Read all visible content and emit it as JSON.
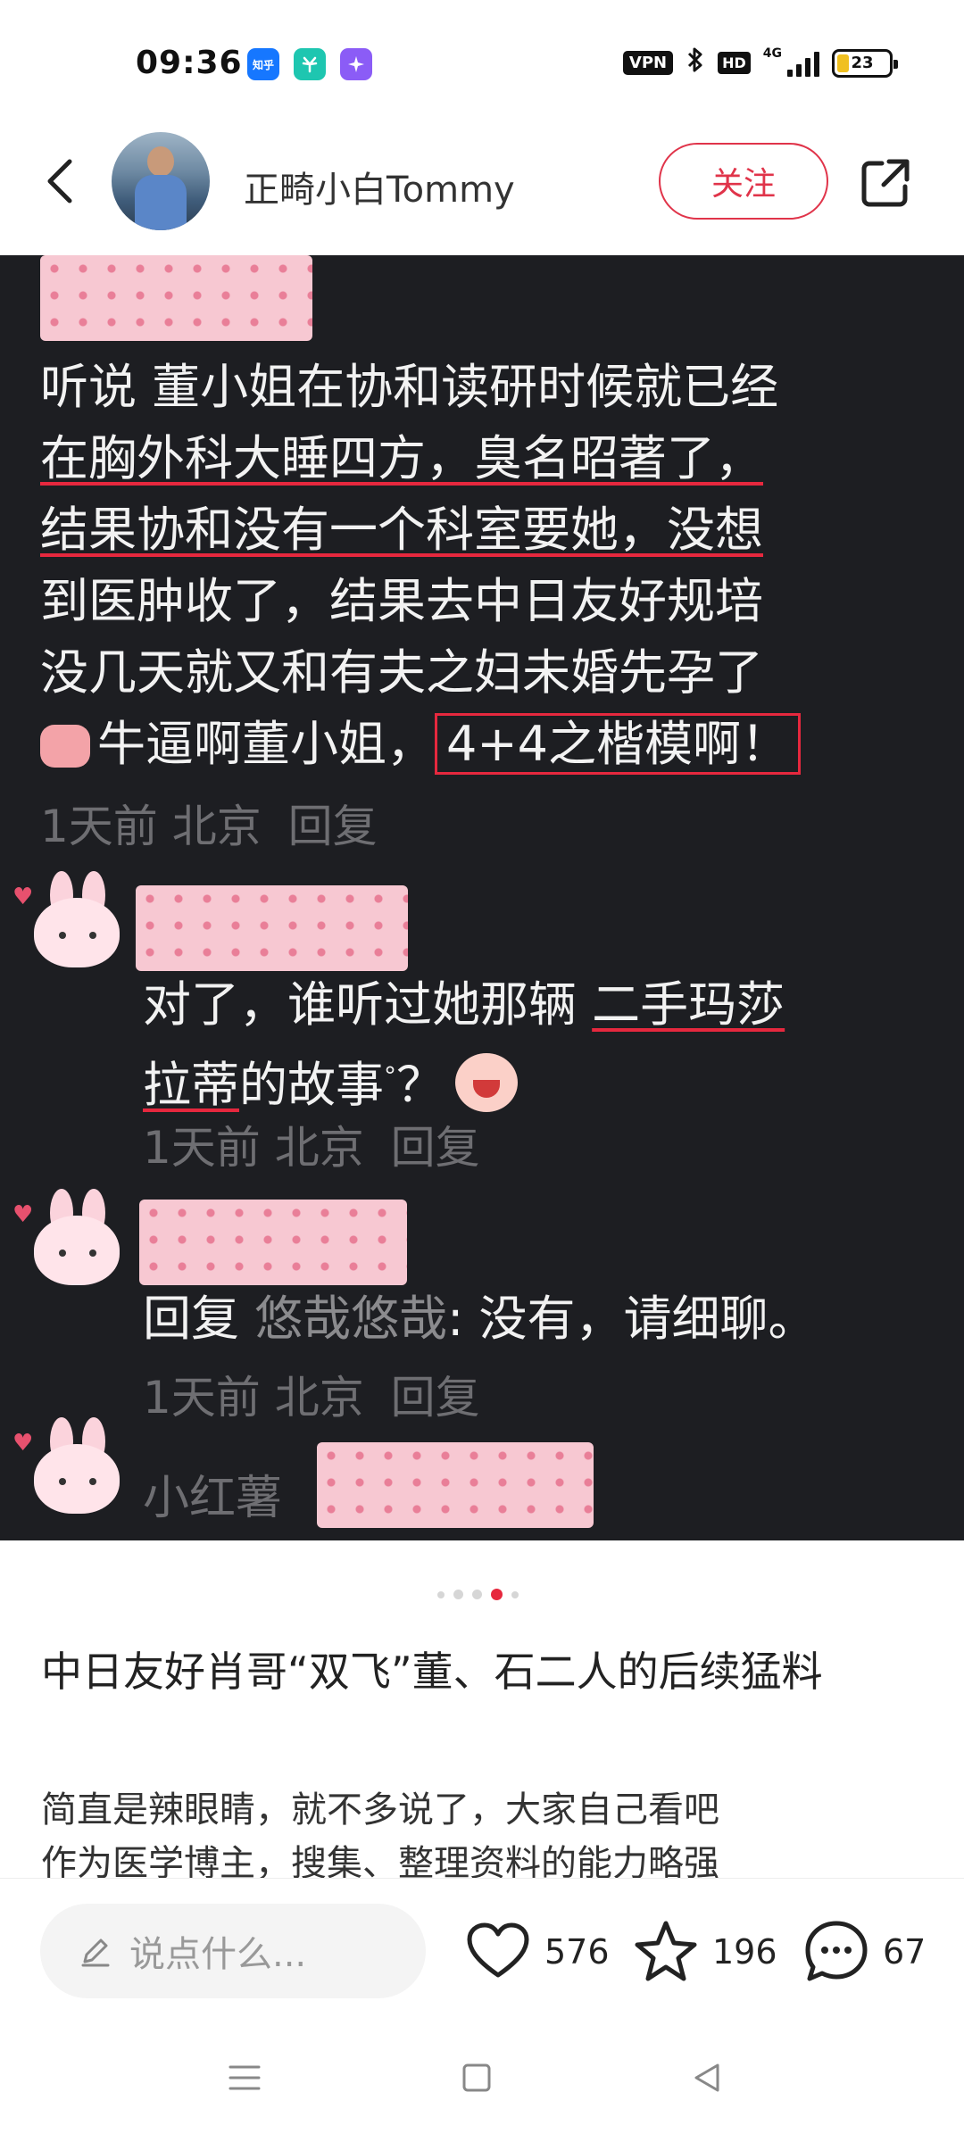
{
  "status_bar": {
    "time": "09:36",
    "app_badges": [
      "知乎",
      "wave",
      "star"
    ],
    "vpn": "VPN",
    "hd": "HD",
    "network": "4G",
    "battery": "23",
    "battery_level": 0.23
  },
  "header": {
    "author_name": "正畸小白Tommy",
    "follow_label": "关注"
  },
  "post_image": {
    "comment1": {
      "lines": [
        "听说 董小姐在协和读研时候就已经",
        "在胸外科大睡四方，臭名昭著了，",
        "结果协和没有一个科室要她，没想",
        "到医肿收了，结果去中日友好规培",
        "没几天就又和有夫之妇未婚先孕了"
      ],
      "last_line_prefix": "牛逼啊董小姐，",
      "last_line_boxed": "4+4之楷模啊！",
      "meta_time": "1天前",
      "meta_loc": "北京",
      "meta_reply": "回复"
    },
    "comment2": {
      "line1_plain": "对了，谁听过她那辆 ",
      "line1_ul": "二手玛莎",
      "line2_ul": "拉蒂",
      "line2_rest": "的故事",
      "line2_end": "？",
      "meta_time": "1天前",
      "meta_loc": "北京",
      "meta_reply": "回复"
    },
    "comment3": {
      "reply_label": "回复",
      "reply_to": "悠哉悠哉",
      "text": ": 没有，请细聊。",
      "meta_time": "1天前",
      "meta_loc": "北京",
      "meta_reply": "回复"
    },
    "comment4": {
      "name": "小红薯"
    }
  },
  "carousel": {
    "count": 5,
    "active_index": 3
  },
  "post": {
    "title": "中日友好肖哥“双飞”董、石二人的后续猛料",
    "body_line1": "简直是辣眼睛，就不多说了，大家自己看吧",
    "body_line2": "作为医学博主，搜集、整理资料的能力略强"
  },
  "action_bar": {
    "comment_placeholder": "说点什么...",
    "likes": "576",
    "favorites": "196",
    "comments": "67"
  }
}
